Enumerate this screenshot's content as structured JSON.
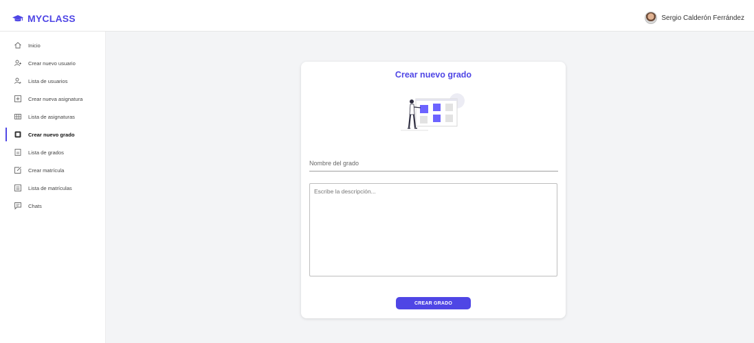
{
  "app": {
    "brand": "MYCLASS",
    "accent": "#4f46e5"
  },
  "header": {
    "user_name": "Sergio Calderón Ferrández"
  },
  "sidebar": {
    "items": [
      {
        "label": "Inicio",
        "icon": "home-icon",
        "active": false
      },
      {
        "label": "Crear nuevo usuario",
        "icon": "user-plus-icon",
        "active": false
      },
      {
        "label": "Lista de usuarios",
        "icon": "users-icon",
        "active": false
      },
      {
        "label": "Crear nueva asignatura",
        "icon": "square-plus-icon",
        "active": false
      },
      {
        "label": "Lista de asignaturas",
        "icon": "list-columns-icon",
        "active": false
      },
      {
        "label": "Crear nuevo grado",
        "icon": "square-filled-icon",
        "active": true
      },
      {
        "label": "Lista de grados",
        "icon": "document-icon",
        "active": false
      },
      {
        "label": "Crear matrícula",
        "icon": "edit-icon",
        "active": false
      },
      {
        "label": "Lista de matrículas",
        "icon": "list-box-icon",
        "active": false
      },
      {
        "label": "Chats",
        "icon": "chat-icon",
        "active": false
      }
    ]
  },
  "form": {
    "title": "Crear nuevo grado",
    "name_placeholder": "Nombre del grado",
    "name_value": "",
    "description_placeholder": "Escribe la descripción...",
    "description_value": "",
    "submit_label": "CREAR GRADO"
  }
}
